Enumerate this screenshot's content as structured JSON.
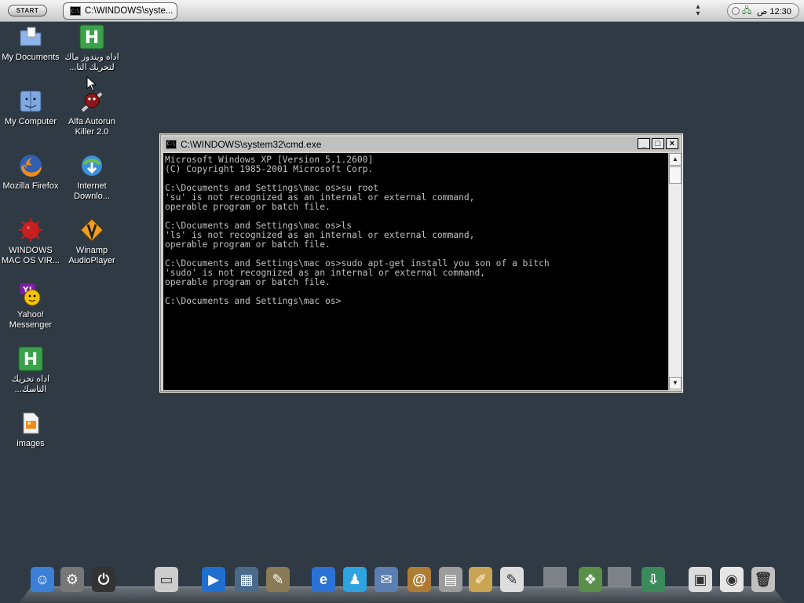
{
  "taskbar": {
    "start_label": "START",
    "task_label": "C:\\WINDOWS\\syste...",
    "clock": "12:30 ص"
  },
  "desktop_icons": [
    {
      "label": "My Documents",
      "icon": "folder-icon"
    },
    {
      "label": "اداه ويندوز ماك\nلتحريك التا...",
      "icon": "h-app-icon"
    },
    {
      "label": "My Computer",
      "icon": "finder-icon"
    },
    {
      "label": "Alfa Autorun\nKiller 2.0",
      "icon": "autorun-killer-icon"
    },
    {
      "label": "Mozilla Firefox",
      "icon": "firefox-icon"
    },
    {
      "label": "Internet\nDownlo...",
      "icon": "internet-download-manager-icon"
    },
    {
      "label": "WINDOWS\nMAC OS VIR...",
      "icon": "virus-icon"
    },
    {
      "label": "Winamp\nAudioPlayer",
      "icon": "winamp-icon"
    },
    {
      "label": "Yahoo!\nMessenger",
      "icon": "yahoo-messenger-icon"
    },
    {
      "label": "اداه تحريك\nالتاسك...",
      "icon": "h-app-icon"
    },
    {
      "label": "images",
      "icon": "image-file-icon"
    }
  ],
  "cmd_window": {
    "title": "C:\\WINDOWS\\system32\\cmd.exe",
    "lines": [
      "Microsoft Windows XP [Version 5.1.2600]",
      "(C) Copyright 1985-2001 Microsoft Corp.",
      "",
      "C:\\Documents and Settings\\mac os>su root",
      "'su' is not recognized as an internal or external command,",
      "operable program or batch file.",
      "",
      "C:\\Documents and Settings\\mac os>ls",
      "'ls' is not recognized as an internal or external command,",
      "operable program or batch file.",
      "",
      "C:\\Documents and Settings\\mac os>sudo apt-get install you son of a bitch",
      "'sudo' is not recognized as an internal or external command,",
      "operable program or batch file.",
      "",
      "C:\\Documents and Settings\\mac os>"
    ]
  },
  "dock_items": [
    {
      "icon": "finder-icon",
      "color": "#3b7fd6"
    },
    {
      "icon": "system-preferences-icon",
      "color": "#777777"
    },
    {
      "icon": "power-icon",
      "color": "#333333"
    },
    {
      "icon": "drive-icon",
      "color": "#cccccc"
    },
    {
      "icon": "media-player-icon",
      "color": "#1f6fd1"
    },
    {
      "icon": "film-icon",
      "color": "#4a6a8a"
    },
    {
      "icon": "tools-icon",
      "color": "#8a7a55"
    },
    {
      "icon": "internet-explorer-icon",
      "color": "#2a72d6"
    },
    {
      "icon": "messenger-icon",
      "color": "#2ea3e0"
    },
    {
      "icon": "mail-icon",
      "color": "#5b7fb0"
    },
    {
      "icon": "address-book-icon",
      "color": "#b07b33"
    },
    {
      "icon": "calculator-icon",
      "color": "#9c9c9c"
    },
    {
      "icon": "textedit-icon",
      "color": "#c9a453"
    },
    {
      "icon": "notepad-icon",
      "color": "#dddddd"
    },
    {
      "icon": "network-icon",
      "color": "#5a8f4a"
    },
    {
      "icon": "download-icon",
      "color": "#3b8a5a"
    },
    {
      "icon": "window-icon",
      "color": "#dcdcdc"
    },
    {
      "icon": "screen-firefox-icon",
      "color": "#e6e6e6"
    },
    {
      "icon": "trash-icon",
      "color": "#bfbfbf"
    }
  ]
}
